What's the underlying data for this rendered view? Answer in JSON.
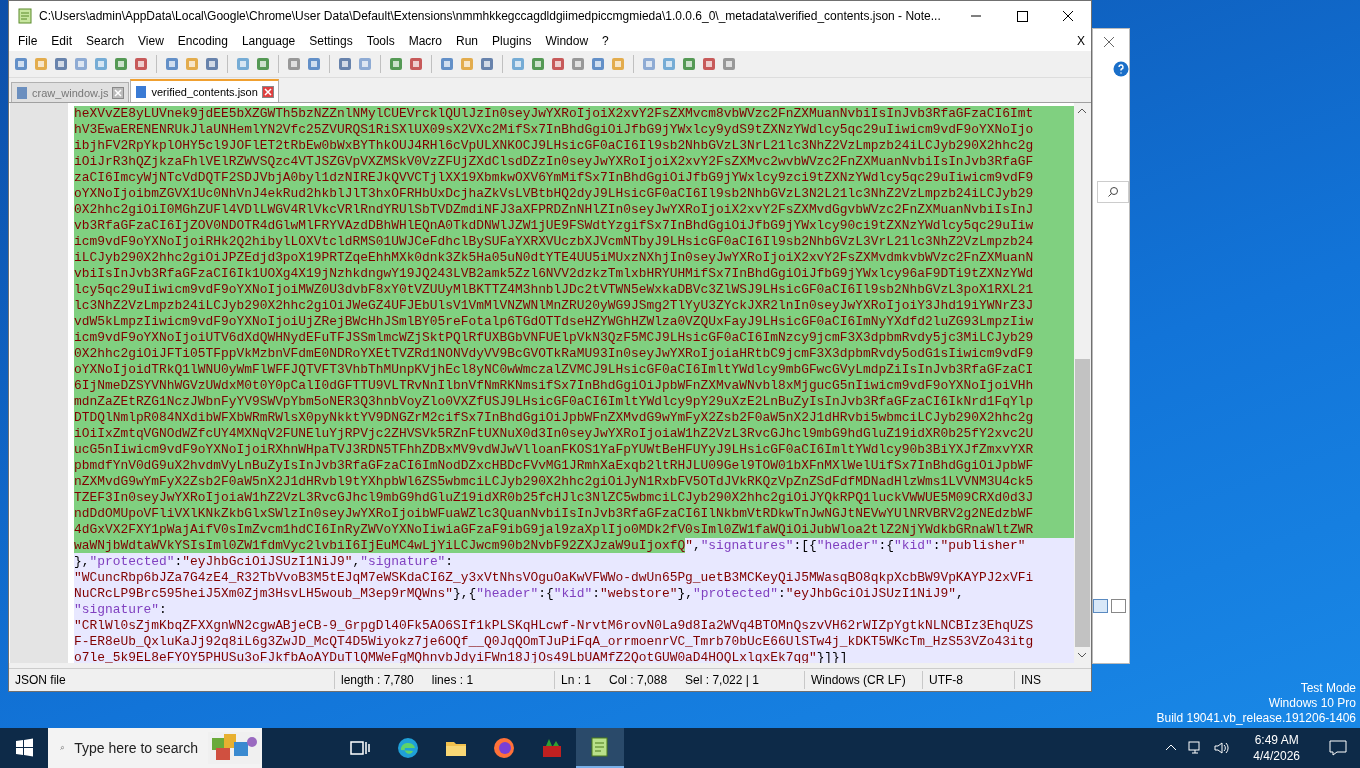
{
  "window": {
    "title": "C:\\Users\\admin\\AppData\\Local\\Google\\Chrome\\User Data\\Default\\Extensions\\nmmhkkegccagdldgiimedpiccmgmieda\\1.0.0.6_0\\_metadata\\verified_contents.json - Note..."
  },
  "menu": {
    "items": [
      "File",
      "Edit",
      "Search",
      "View",
      "Encoding",
      "Language",
      "Settings",
      "Tools",
      "Macro",
      "Run",
      "Plugins",
      "Window",
      "?"
    ],
    "close": "X"
  },
  "tabs": [
    {
      "label": "craw_window.js",
      "selected": false
    },
    {
      "label": "verified_contents.json",
      "selected": true
    }
  ],
  "editor": {
    "rows": [
      {
        "segments": [
          {
            "text": "heXVvZE8yLUVnek9jdEE5bXZGWTh5bzNZZnlNMylCUEVrcklQUlJzIn0seyJwYXRoIjoiX2xvY2FsZXMvcm8vbWVzc2FnZXMuanNvbiIsInJvb3RfaGFzaCI6Imt",
            "kind": "string",
            "selected": true
          }
        ]
      },
      {
        "segments": [
          {
            "text": "hV3EwaERENENRUkJlaUNHemlYN2Vfc25ZVURQS1RiSXlUX09sX2VXc2MifSx7InBhdGgiOiJfbG9jYWxlcy9ydS9tZXNzYWdlcy5qc29uIiwicm9vdF9oYXNoIjo",
            "kind": "string",
            "selected": true
          }
        ]
      },
      {
        "segments": [
          {
            "text": "ibjhFV2RpYkplOHY5cl9JOFlET2tRbEw0bWxBYThkOUJ4RHl6cVpULXNKOCJ9LHsicGF0aCI6Il9sb2NhbGVzL3NrL21lc3NhZ2VzLmpzb24iLCJyb290X2hhc2g",
            "kind": "string",
            "selected": true
          }
        ]
      },
      {
        "segments": [
          {
            "text": "iOiJrR3hQZjkzaFhlVElRZWVSQzc4VTJSZGVpVXZMSkV0VzZFUjZXdClsdDZzIn0seyJwYXRoIjoiX2xvY2FsZXMvc2wvbWVzc2FnZXMuanNvbiIsInJvb3RfaGF",
            "kind": "string",
            "selected": true
          }
        ]
      },
      {
        "segments": [
          {
            "text": "zaCI6ImcyWjNTcVdDQTF2SDJVbjA0byl1dzNIREJkQVVCTjlXX19XbmkwOXV6YmMifSx7InBhdGgiOiJfbG9jYWxlcy9zci9tZXNzYWdlcy5qc29uIiwicm9vdF9",
            "kind": "string",
            "selected": true
          }
        ]
      },
      {
        "segments": [
          {
            "text": "oYXNoIjoibmZGVX1Uc0NhVnJ4ekRud2hkblJlT3hxOFRHbUxDcjhaZkVsLVBtbHQ2dyJ9LHsicGF0aCI6Il9sb2NhbGVzL3N2L21lc3NhZ2VzLmpzb24iLCJyb29",
            "kind": "string",
            "selected": true
          }
        ]
      },
      {
        "segments": [
          {
            "text": "0X2hhc2giOiI0MGhZUFl4VDlLWGV4RlVkcVRlRndYRUlSbTVDZmdiNFJ3aXFPRDZnNHlZIn0seyJwYXRoIjoiX2xvY2FsZXMvdGgvbWVzc2FnZXMuanNvbiIsInJ",
            "kind": "string",
            "selected": true
          }
        ]
      },
      {
        "segments": [
          {
            "text": "vb3RfaGFzaCI6IjZOV0NDOTR4dGlwMlFRYVAzdDBhWHlEQnA0TkdDNWlJZW1jUE9FSWdtYzgifSx7InBhdGgiOiJfbG9jYWxlcy90ci9tZXNzYWdlcy5qc29uIiw",
            "kind": "string",
            "selected": true
          }
        ]
      },
      {
        "segments": [
          {
            "text": "icm9vdF9oYXNoIjoiRHk2Q2hibylLOXVtcldRMS01UWJCeFdhclBySUFaYXRXVUczbXJVcmNTbyJ9LHsicGF0aCI6Il9sb2NhbGVzL3VrL21lc3NhZ2VzLmpzb24",
            "kind": "string",
            "selected": true
          }
        ]
      },
      {
        "segments": [
          {
            "text": "iLCJyb290X2hhc2giOiJPZEdjd3poX19PRTZqeEhhMXk0dnk3Zk5Ha05uN0dtYTE4UU5iMUxzNXhjIn0seyJwYXRoIjoiX2xvY2FsZXMvdmkvbWVzc2FnZXMuanN",
            "kind": "string",
            "selected": true
          }
        ]
      },
      {
        "segments": [
          {
            "text": "vbiIsInJvb3RfaGFzaCI6Ik1UOXg4X19jNzhkdngwY19JQ243LVB2amk5Zzl6NVV2dzkzTmlxbHRYUHMifSx7InBhdGgiOiJfbG9jYWxlcy96aF9DTi9tZXNzYWd",
            "kind": "string",
            "selected": true
          }
        ]
      },
      {
        "segments": [
          {
            "text": "lcy5qc29uIiwicm9vdF9oYXNoIjoiMWZ0U3dvbF8xY0tVZUUyMlBKTTZ4M3hnblJDc2tVTWN5eWxkaDBVc3ZlWSJ9LHsicGF0aCI6Il9sb2NhbGVzL3poX1RXL21",
            "kind": "string",
            "selected": true
          }
        ]
      },
      {
        "segments": [
          {
            "text": "lc3NhZ2VzLmpzb24iLCJyb290X2hhc2giOiJWeGZ4UFJEbUlsV1VmMlVNZWNlMnZRU20yWG9JSmg2TlYyU3ZYckJXR2lnIn0seyJwYXRoIjoiY3Jhd19iYWNrZ3J",
            "kind": "string",
            "selected": true
          }
        ]
      },
      {
        "segments": [
          {
            "text": "vdW5kLmpzIiwicm9vdF9oYXNoIjoiUjZRejBWcHhJSmlBY05reFotalp6TGdOTTdseHZYWGhHZWlza0VZQUxFayJ9LHsicGF0aCI6ImNyYXdfd2luZG93LmpzIiw",
            "kind": "string",
            "selected": true
          }
        ]
      },
      {
        "segments": [
          {
            "text": "icm9vdF9oYXNoIjoiUTV6dXdQWHNydEFuTFJSSmlmcWZjSktPQlRfUXBGbVNFUElpVkN3QzF5MCJ9LHsicGF0aCI6ImNzcy9jcmF3X3dpbmRvdy5jc3MiLCJyb29",
            "kind": "string",
            "selected": true
          }
        ]
      },
      {
        "segments": [
          {
            "text": "0X2hhc2giOiJFTi05TFppVkMzbnVFdmE0NDRoYXEtTVZRd1NONVdyVV9BcGVOTkRaMU93In0seyJwYXRoIjoiaHRtbC9jcmF3X3dpbmRvdy5odG1sIiwicm9vdF9",
            "kind": "string",
            "selected": true
          }
        ]
      },
      {
        "segments": [
          {
            "text": "oYXNoIjoidTRkQ1lWNU0yWmFlWFFJQTVFT3VhbThMUnpKVjhEcl8yNC0wWmczalZVMCJ9LHsicGF0aCI6ImltYWdlcy9mbGFwcGVyLmdpZiIsInJvb3RfaGFzaCI",
            "kind": "string",
            "selected": true
          }
        ]
      },
      {
        "segments": [
          {
            "text": "6IjNmeDZSYVNhWGVzUWdxM0t0Y0pCalI0dGFTTU9VLTRvNnIlbnVfNmRKNmsifSx7InBhdGgiOiJpbWFnZXMvaWNvbl8xMjgucG5nIiwicm9vdF9oYXNoIjoiVHh",
            "kind": "string",
            "selected": true
          }
        ]
      },
      {
        "segments": [
          {
            "text": "mdnZaZEtRZG1NczJWbnFyYV9SWVpYbm5oNER3Q3hnbVoyZlo0VXZfUSJ9LHsicGF0aCI6ImltYWdlcy9pY29uXzE2LnBuZyIsInJvb3RfaGFzaCI6IkNrd1FqYlp",
            "kind": "string",
            "selected": true
          }
        ]
      },
      {
        "segments": [
          {
            "text": "DTDQlNmlpR084NXdibWFXbWRmRWlsX0pyNkktYV9DNGZrM2cifSx7InBhdGgiOiJpbWFnZXMvdG9wYmFyX2Zsb2F0aW5nX2J1dHRvbi5wbmciLCJyb290X2hhc2g",
            "kind": "string",
            "selected": true
          }
        ]
      },
      {
        "segments": [
          {
            "text": "iOiIxZmtqVGNOdWZfcUY4MXNqV2FUNEluYjRPVjc2ZHVSVk5RZnFtUXNuX0d3In0seyJwYXRoIjoiaW1hZ2VzL3RvcGJhcl9mbG9hdGluZ19idXR0b25fY2xvc2U",
            "kind": "string",
            "selected": true
          }
        ]
      },
      {
        "segments": [
          {
            "text": "ucG5nIiwicm9vdF9oYXNoIjoiRXhnWHpaTVJ3RDN5TFhhZDBxMV9vdWJwVlloanFKOS1YaFpYUWtBeHFUYyJ9LHsicGF0aCI6ImltYWdlcy90b3BiYXJfZmxvYXR",
            "kind": "string",
            "selected": true
          }
        ]
      },
      {
        "segments": [
          {
            "text": "pbmdfYnV0dG9uX2hvdmVyLnBuZyIsInJvb3RfaGFzaCI6ImNodDZxcHBDcFVvMG1JRmhXaExqb2ltRHJLU09Gel9TOW01bXFnMXlWelUifSx7InBhdGgiOiJpbWF",
            "kind": "string",
            "selected": true
          }
        ]
      },
      {
        "segments": [
          {
            "text": "nZXMvdG9wYmFyX2Zsb2F0aW5nX2J1dHRvbl9tYXhpbWl6ZS5wbmciLCJyb290X2hhc2giOiJyN1RxbFV5OTdJVkRKQzVpZnZSdFdfMDNadHlzWms1LVVNM3U4ck5",
            "kind": "string",
            "selected": true
          }
        ]
      },
      {
        "segments": [
          {
            "text": "TZEF3In0seyJwYXRoIjoiaW1hZ2VzL3RvcGJhcl9mbG9hdGluZ19idXR0b25fcHJlc3NlZC5wbmciLCJyb290X2hhc2giOiJYQkRPQ1luckVWWUE5M09CRXd0d3J",
            "kind": "string",
            "selected": true
          }
        ]
      },
      {
        "segments": [
          {
            "text": "ndDdOMUpoVFliVXlKNkZkbGlxSWlzIn0seyJwYXRoIjoibWFuaWZlc3QuanNvbiIsInJvb3RfaGFzaCI6IlNkbmVtRDkwTnJwNGJtNEVwYUlNRVBRV2g2NEdzbWF",
            "kind": "string",
            "selected": true
          }
        ]
      },
      {
        "segments": [
          {
            "text": "4dGxVX2FXY1pWajAifV0sImZvcm1hdCI6InRyZWVoYXNoIiwiaGFzaF9ibG9jal9zaXplIjo0MDk2fV0sIml0ZW1faWQiOiJubWloa2tlZ2NjYWdkbGRnaWltZWR",
            "kind": "string",
            "selected": true
          }
        ]
      },
      {
        "segments": [
          {
            "text": "waWNjbWdtaWVkYSIsIml0ZW1fdmVyc2lvbiI6IjEuMC4wLjYiLCJwcm90b2NvbF92ZXJzaW9uIjoxfQ",
            "kind": "string",
            "selected": true
          },
          {
            "text": "\"",
            "kind": "string",
            "selected": false
          },
          {
            "text": ",",
            "kind": "punct",
            "selected": false
          },
          {
            "text": "\"signatures\"",
            "kind": "key",
            "selected": false
          },
          {
            "text": ":[{",
            "kind": "punct",
            "selected": false
          },
          {
            "text": "\"header\"",
            "kind": "key",
            "selected": false
          },
          {
            "text": ":{",
            "kind": "punct",
            "selected": false
          },
          {
            "text": "\"kid\"",
            "kind": "key",
            "selected": false
          },
          {
            "text": ":",
            "kind": "punct",
            "selected": false
          },
          {
            "text": "\"publisher\"",
            "kind": "string",
            "selected": false
          }
        ]
      },
      {
        "segments": [
          {
            "text": "},",
            "kind": "punct",
            "selected": false
          },
          {
            "text": "\"protected\"",
            "kind": "key",
            "selected": false
          },
          {
            "text": ":",
            "kind": "punct",
            "selected": false
          },
          {
            "text": "\"eyJhbGciOiJSUzI1NiJ9\"",
            "kind": "string",
            "selected": false
          },
          {
            "text": ",",
            "kind": "punct",
            "selected": false
          },
          {
            "text": "\"signature\"",
            "kind": "key",
            "selected": false
          },
          {
            "text": ":",
            "kind": "punct",
            "selected": false
          }
        ]
      },
      {
        "segments": [
          {
            "text": "\"WCuncRbp6bJZa7G4zE4_R32TbVvoB3M5tEJqM7eWSKdaCI6Z_y3xVtNhsVOguOaKwVFWWo-dwUn65Pg_uetB3MCKeyQiJ5MWasqBO8qkpXcbBW9VpKAYPJ2xVFi",
            "kind": "string",
            "selected": false
          }
        ]
      },
      {
        "segments": [
          {
            "text": "NuCRcLP9Brc595heiJ5Xm0Zjm3HsvLH5woub_M3ep9rMQWns\"",
            "kind": "string",
            "selected": false
          },
          {
            "text": "},{",
            "kind": "punct",
            "selected": false
          },
          {
            "text": "\"header\"",
            "kind": "key",
            "selected": false
          },
          {
            "text": ":{",
            "kind": "punct",
            "selected": false
          },
          {
            "text": "\"kid\"",
            "kind": "key",
            "selected": false
          },
          {
            "text": ":",
            "kind": "punct",
            "selected": false
          },
          {
            "text": "\"webstore\"",
            "kind": "string",
            "selected": false
          },
          {
            "text": "},",
            "kind": "punct",
            "selected": false
          },
          {
            "text": "\"protected\"",
            "kind": "key",
            "selected": false
          },
          {
            "text": ":",
            "kind": "punct",
            "selected": false
          },
          {
            "text": "\"eyJhbGciOiJSUzI1NiJ9\"",
            "kind": "string",
            "selected": false
          },
          {
            "text": ",",
            "kind": "punct",
            "selected": false
          }
        ]
      },
      {
        "segments": [
          {
            "text": "\"signature\"",
            "kind": "key",
            "selected": false
          },
          {
            "text": ":",
            "kind": "punct",
            "selected": false
          }
        ]
      },
      {
        "segments": [
          {
            "text": "\"CRlWl0sZjmKbqZFXXgnWN2cgwABjeCB-9_GrpgDl40Fk5AO6SIf1kPLSKqHLcwf-NrvtM6rovN0La9d8Ia2WVq4BTOMnQszvVH62rWIZpYgtkNLNCBIz3EhqUZS",
            "kind": "string",
            "selected": false
          }
        ]
      },
      {
        "segments": [
          {
            "text": "F-ER8eUb_QxluKaJj92q8iL6g3ZwJD_McQT4D5Wiyokz7je6OQf__Q0JqQOmTJuPiFqA_orrmoenrVC_Tmrb70bUcE66UlSTw4j_kDKT5WKcTm_HzS53VZo43itg",
            "kind": "string",
            "selected": false
          }
        ]
      },
      {
        "segments": [
          {
            "text": "o7le_5k9EL8eFYOY5PHUSu3oFJkfbAoAYDuTlQMWeFgMQhnvbJdyiFWn18JjOs49LbUAMfZ2QotGUW0aD4HOQLxlqxEk7qg\"",
            "kind": "string",
            "selected": false
          },
          {
            "text": "}]}]",
            "kind": "punct",
            "selected": false
          }
        ]
      }
    ]
  },
  "status_bar": {
    "file_type": "JSON file",
    "length": "length : 7,780",
    "lines": "lines : 1",
    "ln": "Ln : 1",
    "col": "Col : 7,088",
    "sel": "Sel : 7,022 | 1",
    "eol": "Windows (CR LF)",
    "encoding": "UTF-8",
    "mode": "INS"
  },
  "desktop": {
    "notice": [
      "Test Mode",
      "Windows 10 Pro",
      "Build 19041.vb_release.191206-1406"
    ]
  },
  "taskbar": {
    "search_placeholder": "Type here to search",
    "apps": [
      {
        "kind": "task-view",
        "active": false
      },
      {
        "kind": "edge",
        "active": false
      },
      {
        "kind": "explorer",
        "active": false
      },
      {
        "kind": "firefox",
        "active": false
      },
      {
        "kind": "app",
        "active": false
      },
      {
        "kind": "notepad",
        "active": true
      }
    ],
    "time": "6:49 AM",
    "date": "4/4/2026"
  }
}
